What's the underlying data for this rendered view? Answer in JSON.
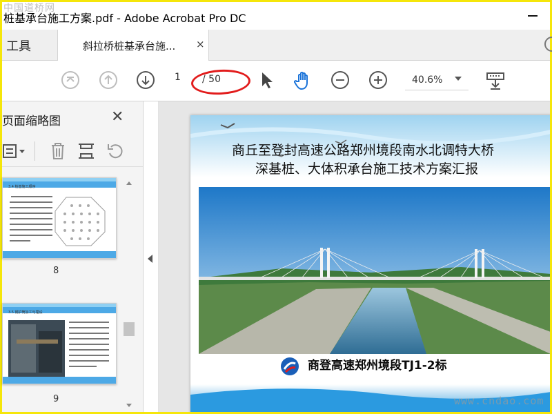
{
  "window": {
    "title": "桩基承台施工方案.pdf - Adobe Acrobat Pro DC"
  },
  "watermarks": {
    "top_left": "中国道桥网",
    "bottom_right": "www.cndao.com"
  },
  "tabs": {
    "tools": "工具",
    "document": "斜拉桥桩基承台施...",
    "close": "×"
  },
  "toolbar": {
    "page_current": "1",
    "page_total": "/ 50",
    "zoom": "40.6%",
    "icons": [
      "scroll-top-icon",
      "page-up-icon",
      "page-down-icon",
      "select-cursor-icon",
      "hand-tool-icon",
      "zoom-out-icon",
      "zoom-in-icon",
      "keyboard-icon"
    ]
  },
  "sidebar": {
    "title": "页面缩略图",
    "close": "✕",
    "thumbnails": [
      {
        "page": "8"
      },
      {
        "page": "9"
      }
    ]
  },
  "document": {
    "title_line1": "商丘至登封高速公路郑州境段南水北调特大桥",
    "title_line2": "深基桩、大体积承台施工技术方案汇报",
    "subtitle": "商登高速郑州境段TJ1-2标"
  },
  "colors": {
    "annotation_red": "#e21c1c",
    "window_border": "#f5e60a",
    "sky_blue": "#4da9e6"
  }
}
